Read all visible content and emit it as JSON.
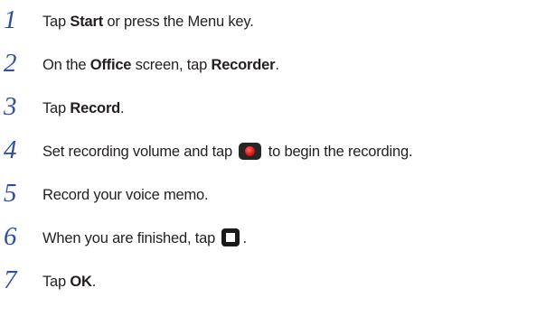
{
  "steps": [
    {
      "number": "1",
      "t1": "Tap ",
      "b1": "Start",
      "t2": " or press the Menu key."
    },
    {
      "number": "2",
      "t1": "On the ",
      "b1": "Office",
      "t2": " screen, tap ",
      "b2": "Recorder",
      "t3": "."
    },
    {
      "number": "3",
      "t1": "Tap ",
      "b1": "Record",
      "t2": "."
    },
    {
      "number": "4",
      "t1": "Set recording volume and tap ",
      "t2": " to begin the recording."
    },
    {
      "number": "5",
      "t1": "Record your voice memo."
    },
    {
      "number": "6",
      "t1": "When you are finished, tap ",
      "t2": "."
    },
    {
      "number": "7",
      "t1": "Tap ",
      "b1": "OK",
      "t2": "."
    }
  ],
  "icons": {
    "record": "record-icon",
    "stop": "stop-icon"
  },
  "colors": {
    "step_number": "#2f4fa0",
    "text": "#231f20"
  }
}
